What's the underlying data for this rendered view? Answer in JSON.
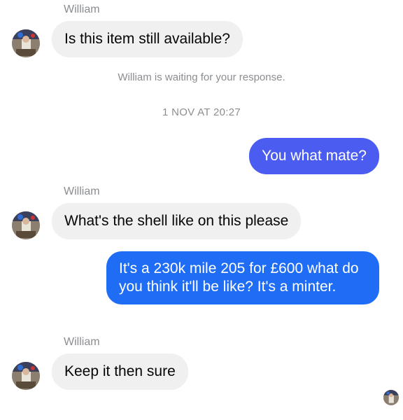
{
  "conversation": {
    "sender_name": "William",
    "messages": [
      {
        "sender": "William",
        "direction": "incoming",
        "text": "Is this item still available?"
      },
      {
        "direction": "system",
        "text": "William is waiting for your response."
      },
      {
        "direction": "timestamp",
        "text": "1 NOV AT 20:27"
      },
      {
        "direction": "outgoing",
        "text": "You what mate?"
      },
      {
        "sender": "William",
        "direction": "incoming",
        "text": "What's the shell like on this please"
      },
      {
        "direction": "outgoing",
        "text": "It's a 230k mile 205 for £600 what do you think it'll be like? It's a minter."
      },
      {
        "sender": "William",
        "direction": "incoming",
        "text": "Keep it then sure"
      }
    ]
  },
  "colors": {
    "incoming_bubble": "#f0f0f0",
    "outgoing_bubble_1": "#4b5df0",
    "outgoing_bubble_2": "#1f6cf5",
    "meta_text": "#8a8d91"
  },
  "icons": {
    "avatar": "profile-photo-icon",
    "read_receipt": "read-receipt-avatar-icon"
  }
}
